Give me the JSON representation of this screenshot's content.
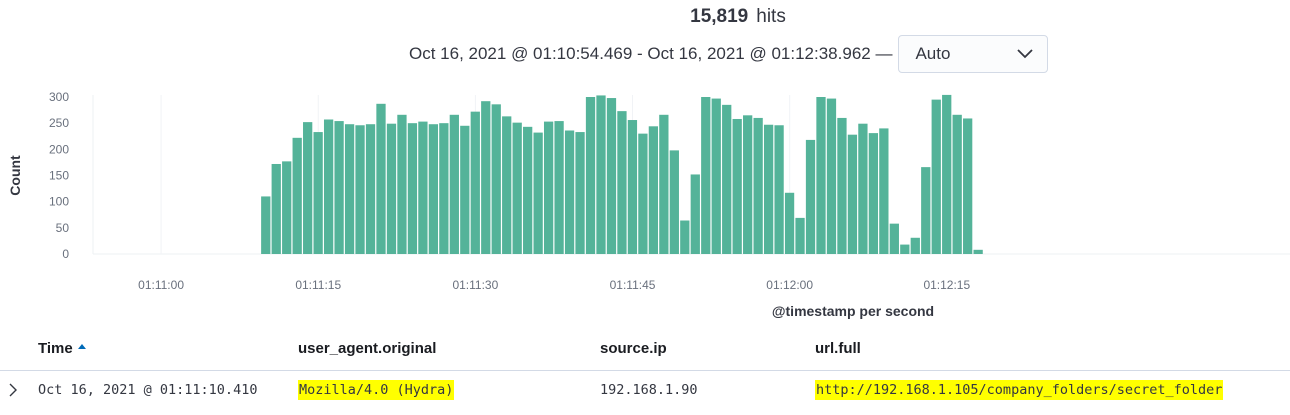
{
  "hits": {
    "count": "15,819",
    "label": "hits"
  },
  "time_range": {
    "text": "Oct 16, 2021 @ 01:10:54.469 - Oct 16, 2021 @ 01:12:38.962 —"
  },
  "interval": {
    "selected": "Auto"
  },
  "chart_data": {
    "type": "bar",
    "xlabel": "@timestamp per second",
    "ylabel": "Count",
    "ylim": [
      0,
      300
    ],
    "yticks": [
      0,
      50,
      100,
      150,
      200,
      250,
      300
    ],
    "xticks": [
      "01:11:00",
      "01:11:15",
      "01:11:30",
      "01:11:45",
      "01:12:00",
      "01:12:15"
    ],
    "x_start": "01:10:54",
    "x_end": "01:12:38",
    "first_bar_time": "01:11:10",
    "values": [
      110,
      172,
      177,
      222,
      252,
      233,
      257,
      254,
      248,
      246,
      248,
      287,
      249,
      266,
      250,
      253,
      248,
      250,
      266,
      245,
      272,
      292,
      286,
      263,
      251,
      243,
      232,
      253,
      254,
      236,
      233,
      300,
      303,
      298,
      273,
      256,
      230,
      244,
      266,
      198,
      64,
      152,
      300,
      297,
      285,
      258,
      265,
      260,
      247,
      246,
      117,
      69,
      218,
      300,
      297,
      260,
      228,
      249,
      231,
      240,
      58,
      18,
      31,
      166,
      295,
      304,
      266,
      259,
      8
    ],
    "color": "#54b399",
    "grid": true
  },
  "table": {
    "columns": [
      {
        "label": "Time"
      },
      {
        "label": "user_agent.original"
      },
      {
        "label": "source.ip"
      },
      {
        "label": "url.full"
      }
    ],
    "rows": [
      {
        "time": "Oct 16, 2021 @ 01:11:10.410",
        "user_agent": "Mozilla/4.0 (Hydra)",
        "source_ip": "192.168.1.90",
        "url": "http://192.168.1.105/company_folders/secret_folder"
      }
    ],
    "highlight_color": "#ffff00"
  }
}
